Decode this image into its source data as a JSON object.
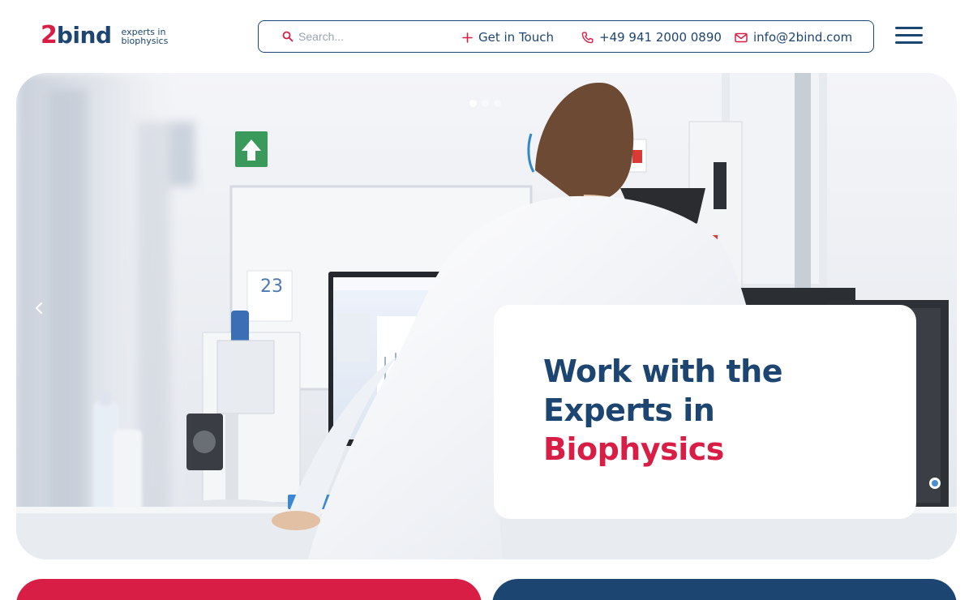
{
  "brand": {
    "logo_mark": "2",
    "logo_word": "bind",
    "tagline_line1": "experts in",
    "tagline_line2": "biophysics",
    "primary_color": "#1d4571",
    "accent_color": "#d81e45"
  },
  "header": {
    "search_placeholder": "Search...",
    "search_icon": "search-icon",
    "get_in_touch_label": "Get in Touch",
    "get_in_touch_icon": "plus-icon",
    "phone_label": "+49 941 2000 0890",
    "phone_icon": "phone-icon",
    "email_label": "info@2bind.com",
    "email_icon": "mail-icon",
    "menu_icon": "hamburger-menu-icon"
  },
  "hero": {
    "title_line1": "Work with the",
    "title_line2": "Experts in",
    "title_line3": "Biophysics",
    "slides_count": 3,
    "active_slide": 1,
    "prev_icon": "chevron-left-icon",
    "image_alt": "Scientist in lab coat working at laboratory bench with monitor and equipment"
  },
  "bottom_cards": [
    {
      "color": "#d81e45"
    },
    {
      "color": "#1d4571"
    }
  ]
}
